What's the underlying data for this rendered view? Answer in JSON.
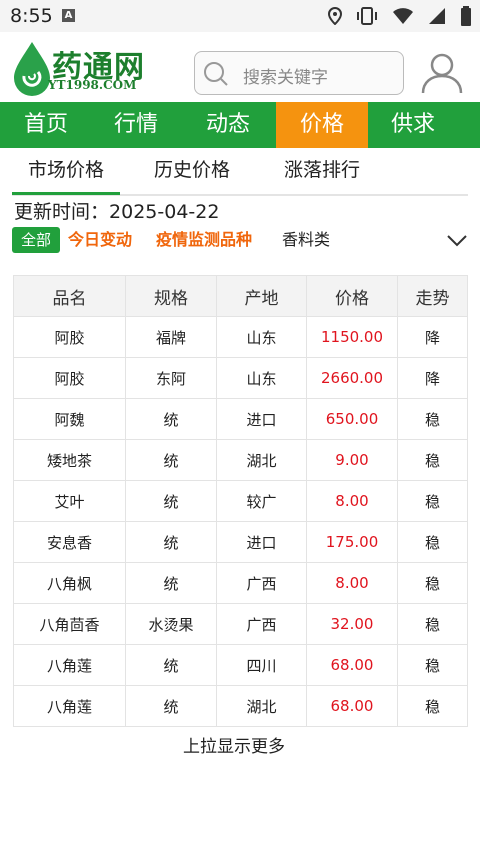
{
  "status_bar": {
    "time": "8:55",
    "notification_badge": "A"
  },
  "header": {
    "logo_main": "药通网",
    "logo_sub": "YT1998.COM",
    "search_placeholder": "搜索关键字"
  },
  "nav": {
    "items": [
      "首页",
      "行情",
      "动态",
      "价格",
      "供求"
    ],
    "active_index": 3
  },
  "sub_tabs": {
    "items": [
      "市场价格",
      "历史价格",
      "涨落排行"
    ],
    "active_index": 0
  },
  "update": {
    "label": "更新时间：",
    "date": "2025-04-22"
  },
  "filters": {
    "all": "全部",
    "today_change": "今日变动",
    "epidemic": "疫情监测品种",
    "category": "香料类"
  },
  "table": {
    "headers": [
      "品名",
      "规格",
      "产地",
      "价格",
      "走势"
    ],
    "rows": [
      [
        "阿胶",
        "福牌",
        "山东",
        "1150.00",
        "降"
      ],
      [
        "阿胶",
        "东阿",
        "山东",
        "2660.00",
        "降"
      ],
      [
        "阿魏",
        "统",
        "进口",
        "650.00",
        "稳"
      ],
      [
        "矮地茶",
        "统",
        "湖北",
        "9.00",
        "稳"
      ],
      [
        "艾叶",
        "统",
        "较广",
        "8.00",
        "稳"
      ],
      [
        "安息香",
        "统",
        "进口",
        "175.00",
        "稳"
      ],
      [
        "八角枫",
        "统",
        "广西",
        "8.00",
        "稳"
      ],
      [
        "八角茴香",
        "水烫果",
        "广西",
        "32.00",
        "稳"
      ],
      [
        "八角莲",
        "统",
        "四川",
        "68.00",
        "稳"
      ],
      [
        "八角莲",
        "统",
        "湖北",
        "68.00",
        "稳"
      ]
    ]
  },
  "load_more": "上拉显示更多",
  "colors": {
    "brand_green": "#21a03c",
    "active_orange": "#f5930f",
    "price_red": "#e0141e",
    "highlight_orange": "#f0660c"
  }
}
